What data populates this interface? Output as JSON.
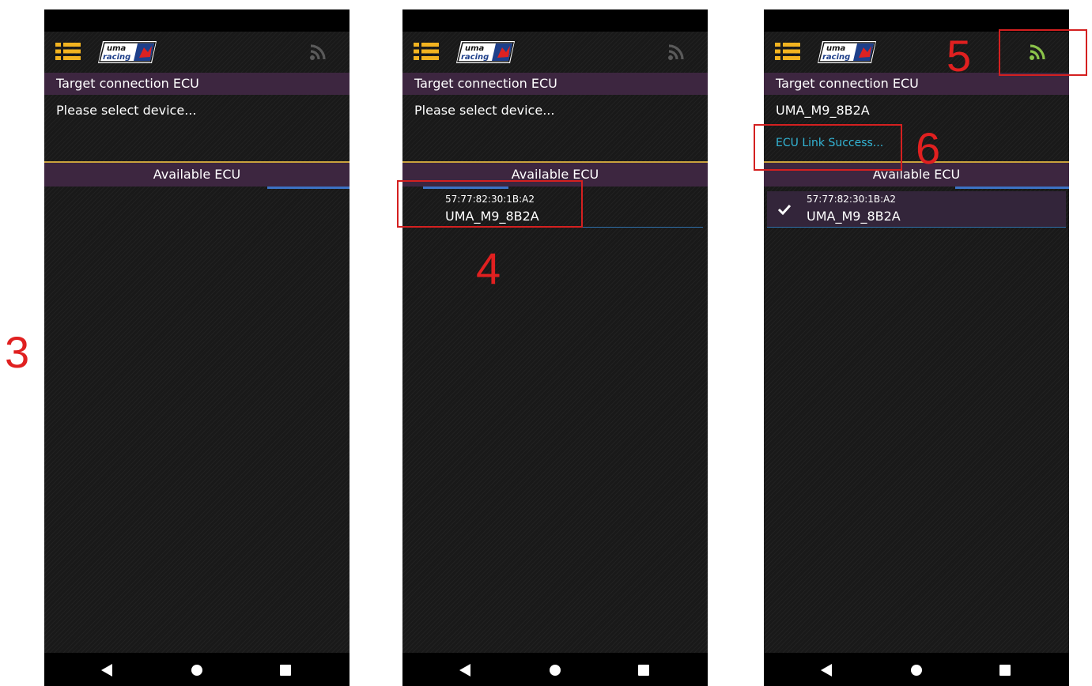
{
  "colors": {
    "accent": "#f2b320",
    "header_bg": "#3d2640",
    "status_text": "#33b5d6",
    "annotation": "#e02020",
    "connected_icon": "#8bc34a"
  },
  "icons": {
    "menu": "menu-list-icon",
    "wifi": "wifi-signal-icon",
    "check": "check-icon",
    "back": "nav-back-icon",
    "home": "nav-home-icon",
    "recent": "nav-recent-icon"
  },
  "logo_text": {
    "line1": "uma",
    "line2": "racing"
  },
  "screens": [
    {
      "target_header": "Target connection ECU",
      "target_value": "Please select device...",
      "available_header": "Available ECU",
      "devices": [],
      "connected": false
    },
    {
      "target_header": "Target connection ECU",
      "target_value": "Please select device...",
      "available_header": "Available ECU",
      "devices": [
        {
          "mac": "57:77:82:30:1B:A2",
          "name": "UMA_M9_8B2A"
        }
      ],
      "connected": false
    },
    {
      "target_header": "Target connection ECU",
      "target_value": "UMA_M9_8B2A",
      "status": "ECU Link Success...",
      "available_header": "Available ECU",
      "devices": [
        {
          "mac": "57:77:82:30:1B:A2",
          "name": "UMA_M9_8B2A",
          "selected": true
        }
      ],
      "connected": true
    }
  ],
  "annotations": {
    "step3": "3",
    "step4": "4",
    "step5": "5",
    "step6": "6"
  }
}
